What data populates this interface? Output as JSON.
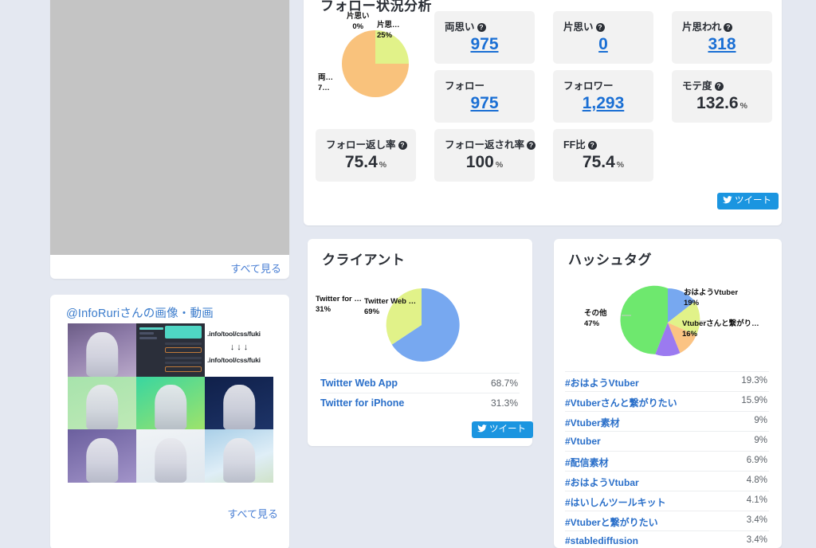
{
  "theme": {
    "page_bg": "#e4e8f1",
    "card_bg": "#ffffff",
    "accent_blue": "#1b95e0",
    "link_blue": "#1a6fd4",
    "stat_bg": "#f2f2f2"
  },
  "left_column": {
    "media_card": {
      "placeholder_name": "media-placeholder",
      "see_all_label": "すべて見る"
    },
    "images_card": {
      "title": "@InfoRuriさんの画像・動画",
      "see_all_label": "すべて見る",
      "thumbnails": [
        {
          "name": "thumb-portrait-blue-crystal"
        },
        {
          "name": "thumb-dark-code-editor"
        },
        {
          "name": "thumb-fuki-text",
          "line1": ".info/tool/css/fuki",
          "arrows": "↓ ↓ ↓",
          "line2": ".info/tool/css/fuki"
        },
        {
          "name": "thumb-portrait-green-rose"
        },
        {
          "name": "thumb-portrait-teal-smile"
        },
        {
          "name": "thumb-portrait-dark-room"
        },
        {
          "name": "thumb-portrait-purple"
        },
        {
          "name": "thumb-portrait-white-dress"
        },
        {
          "name": "thumb-portrait-sky-dress"
        }
      ]
    }
  },
  "follow_card": {
    "title": "フォロー状況分析",
    "tweet_label": "ツイート",
    "stats": [
      {
        "label": "両思い",
        "help": true,
        "value": "975",
        "unit": "",
        "link": true
      },
      {
        "label": "片思い",
        "help": true,
        "value": "0",
        "unit": "",
        "link": true
      },
      {
        "label": "片思われ",
        "help": true,
        "value": "318",
        "unit": "",
        "link": true
      },
      {
        "label": "フォロー",
        "help": false,
        "value": "975",
        "unit": "",
        "link": true
      },
      {
        "label": "フォロワー",
        "help": false,
        "value": "1,293",
        "unit": "",
        "link": true
      },
      {
        "label": "モテ度",
        "help": true,
        "value": "132.6",
        "unit": "%",
        "link": false
      },
      {
        "label": "フォロー返し率",
        "help": true,
        "value": "75.4",
        "unit": "%",
        "link": false
      },
      {
        "label": "フォロー返され率",
        "help": true,
        "value": "100",
        "unit": "%",
        "link": false
      },
      {
        "label": "FF比",
        "help": true,
        "value": "75.4",
        "unit": "%",
        "link": false
      }
    ],
    "chart_data": {
      "type": "pie",
      "title": "フォロー状況分析",
      "labels": [
        "両思い",
        "片思われ",
        "片思い"
      ],
      "display_labels": [
        "両…\n7…",
        "片思…\n25%",
        "片思い\n0%"
      ],
      "values": [
        75,
        25,
        0
      ],
      "percent_text": [
        "75%",
        "25%",
        "0%"
      ],
      "colors": [
        "#f9c27c",
        "#e1f289",
        "#b7e86b"
      ],
      "legend": "none"
    }
  },
  "client_card": {
    "title": "クライアント",
    "tweet_label": "ツイート",
    "rows": [
      {
        "name": "Twitter Web App",
        "pct": "68.7%"
      },
      {
        "name": "Twitter for iPhone",
        "pct": "31.3%"
      }
    ],
    "chart_data": {
      "type": "pie",
      "title": "クライアント",
      "labels": [
        "Twitter Web App",
        "Twitter for iPhone"
      ],
      "display_labels": [
        "Twitter Web …\n69%",
        "Twitter for …\n31%"
      ],
      "values": [
        68.7,
        31.3
      ],
      "percent_text": [
        "69%",
        "31%"
      ],
      "colors": [
        "#77a8f0",
        "#e1f289"
      ],
      "legend": "none"
    }
  },
  "hashtag_card": {
    "title": "ハッシュタグ",
    "rows": [
      {
        "name": "#おはようVtuber",
        "pct": "19.3%"
      },
      {
        "name": "#Vtuberさんと繋がりたい",
        "pct": "15.9%"
      },
      {
        "name": "#Vtuber素材",
        "pct": "9%"
      },
      {
        "name": "#Vtuber",
        "pct": "9%"
      },
      {
        "name": "#配信素材",
        "pct": "6.9%"
      },
      {
        "name": "#おはようVtubar",
        "pct": "4.8%"
      },
      {
        "name": "#はいしんツールキット",
        "pct": "4.1%"
      },
      {
        "name": "#Vtuberと繋がりたい",
        "pct": "3.4%"
      },
      {
        "name": "#stablediffusion",
        "pct": "3.4%"
      }
    ],
    "chart_data": {
      "type": "pie",
      "title": "ハッシュタグ",
      "labels": [
        "その他",
        "おはようVtuber",
        "Vtuberさんと繋がり…",
        "slice-4",
        "slice-5"
      ],
      "display_labels": [
        "その他\n47%",
        "おはようVtuber\n19%",
        "Vtuberさんと繋がり…\n16%"
      ],
      "values": [
        47,
        19,
        16,
        9,
        9
      ],
      "percent_text": [
        "47%",
        "19%",
        "16%",
        "9%",
        "9%"
      ],
      "colors": [
        "#6ee86e",
        "#77a8f0",
        "#e1f289",
        "#fbc383",
        "#9b7af0"
      ],
      "legend": "none"
    }
  }
}
